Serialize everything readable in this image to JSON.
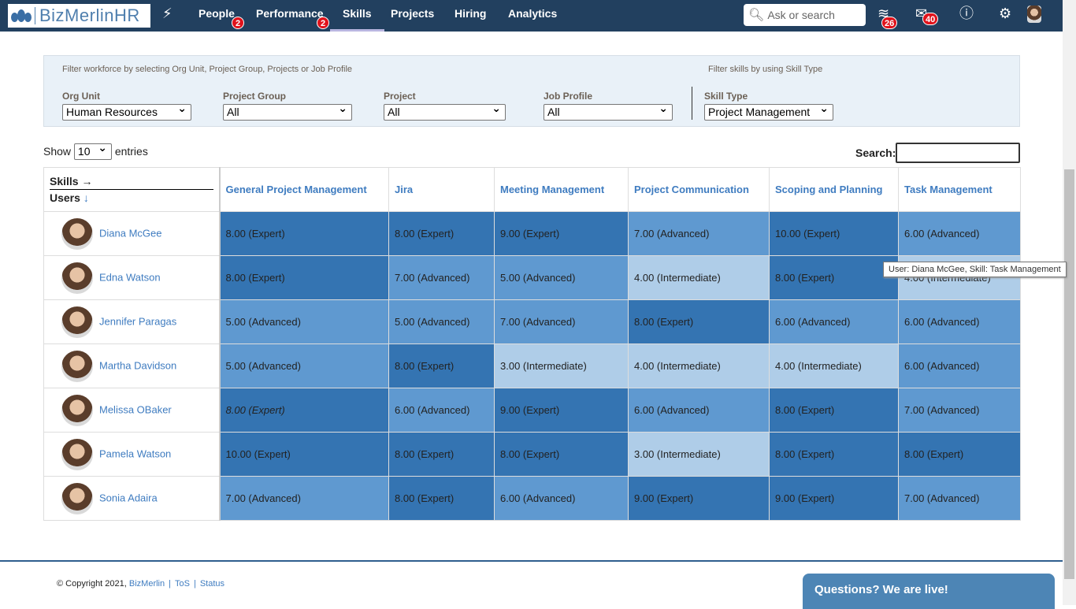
{
  "header": {
    "logo": "BizMerlinHR",
    "nav": [
      {
        "label": "People",
        "badge": "2"
      },
      {
        "label": "Performance",
        "badge": "2"
      },
      {
        "label": "Skills",
        "active": true
      },
      {
        "label": "Projects"
      },
      {
        "label": "Hiring"
      },
      {
        "label": "Analytics"
      }
    ],
    "search_placeholder": "Ask or search",
    "stack_badge": "26",
    "mail_badge": "40"
  },
  "filters": {
    "workforce_note": "Filter workforce by selecting Org Unit, Project Group, Projects or Job Profile",
    "skill_note": "Filter skills by using Skill Type",
    "org_unit": {
      "label": "Org Unit",
      "value": "Human Resources"
    },
    "project_group": {
      "label": "Project Group",
      "value": "All"
    },
    "project": {
      "label": "Project",
      "value": "All"
    },
    "job_profile": {
      "label": "Job Profile",
      "value": "All"
    },
    "skill_type": {
      "label": "Skill Type",
      "value": "Project Management"
    }
  },
  "table_controls": {
    "show": "Show",
    "entries_value": "10",
    "entries": "entries",
    "search_label": "Search:"
  },
  "table": {
    "corner_skills": "Skills →",
    "corner_users": "Users",
    "corner_arrow": "↓",
    "skills": [
      "General Project Management",
      "Jira",
      "Meeting Management",
      "Project Communication",
      "Scoping and Planning",
      "Task Management"
    ],
    "rows": [
      {
        "user": "Diana McGee",
        "cells": [
          [
            "8.00 (Expert)",
            "Expert"
          ],
          [
            "8.00 (Expert)",
            "Expert"
          ],
          [
            "9.00 (Expert)",
            "Expert"
          ],
          [
            "7.00 (Advanced)",
            "Advanced"
          ],
          [
            "10.00 (Expert)",
            "Expert"
          ],
          [
            "6.00 (Advanced)",
            "Advanced"
          ]
        ]
      },
      {
        "user": "Edna Watson",
        "cells": [
          [
            "8.00 (Expert)",
            "Expert"
          ],
          [
            "7.00 (Advanced)",
            "Advanced"
          ],
          [
            "5.00 (Advanced)",
            "Advanced"
          ],
          [
            "4.00 (Intermediate)",
            "Intermediate"
          ],
          [
            "8.00 (Expert)",
            "Expert"
          ],
          [
            "4.00 (Intermediate)",
            "Intermediate"
          ]
        ]
      },
      {
        "user": "Jennifer Paragas",
        "cells": [
          [
            "5.00 (Advanced)",
            "Advanced"
          ],
          [
            "5.00 (Advanced)",
            "Advanced"
          ],
          [
            "7.00 (Advanced)",
            "Advanced"
          ],
          [
            "8.00 (Expert)",
            "Expert"
          ],
          [
            "6.00 (Advanced)",
            "Advanced"
          ],
          [
            "6.00 (Advanced)",
            "Advanced"
          ]
        ]
      },
      {
        "user": "Martha Davidson",
        "cells": [
          [
            "5.00 (Advanced)",
            "Advanced"
          ],
          [
            "8.00 (Expert)",
            "Expert"
          ],
          [
            "3.00 (Intermediate)",
            "Intermediate"
          ],
          [
            "4.00 (Intermediate)",
            "Intermediate"
          ],
          [
            "4.00 (Intermediate)",
            "Intermediate"
          ],
          [
            "6.00 (Advanced)",
            "Advanced"
          ]
        ]
      },
      {
        "user": "Melissa OBaker",
        "cells": [
          [
            "8.00 (Expert)",
            "Expert"
          ],
          [
            "6.00 (Advanced)",
            "Advanced"
          ],
          [
            "9.00 (Expert)",
            "Expert"
          ],
          [
            "6.00 (Advanced)",
            "Advanced"
          ],
          [
            "8.00 (Expert)",
            "Expert"
          ],
          [
            "7.00 (Advanced)",
            "Advanced"
          ]
        ]
      },
      {
        "user": "Pamela Watson",
        "cells": [
          [
            "10.00 (Expert)",
            "Expert"
          ],
          [
            "8.00 (Expert)",
            "Expert"
          ],
          [
            "8.00 (Expert)",
            "Expert"
          ],
          [
            "3.00 (Intermediate)",
            "Intermediate"
          ],
          [
            "8.00 (Expert)",
            "Expert"
          ],
          [
            "8.00 (Expert)",
            "Expert"
          ]
        ]
      },
      {
        "user": "Sonia Adaira",
        "cells": [
          [
            "7.00 (Advanced)",
            "Advanced"
          ],
          [
            "8.00 (Expert)",
            "Expert"
          ],
          [
            "6.00 (Advanced)",
            "Advanced"
          ],
          [
            "9.00 (Expert)",
            "Expert"
          ],
          [
            "9.00 (Expert)",
            "Expert"
          ],
          [
            "7.00 (Advanced)",
            "Advanced"
          ]
        ]
      }
    ]
  },
  "tooltip": "User: Diana McGee, Skill: Task Management",
  "footer": {
    "copyright": "© Copyright 2021,",
    "brand": "BizMerlin",
    "tos": "ToS",
    "status": "Status",
    "sep": "|"
  },
  "chat": "Questions? We are live!",
  "colors": {
    "header": "#22405f",
    "expert": "#3474b2",
    "advanced": "#5f99d0",
    "intermediate": "#afcde8",
    "link": "#3f7cc0"
  }
}
